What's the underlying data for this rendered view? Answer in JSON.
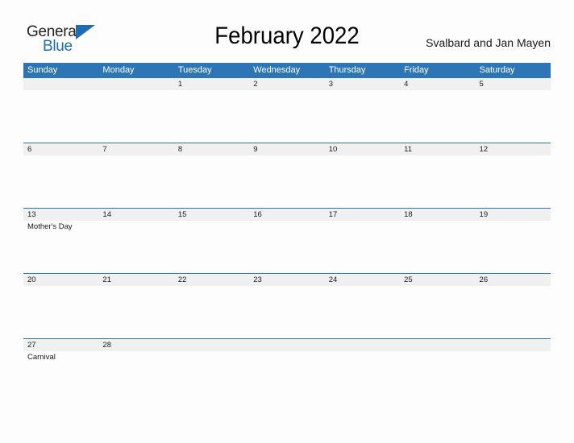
{
  "brand": {
    "name_part1": "General",
    "name_part2": "Blue",
    "triangle_icon": "triangle-icon",
    "color_primary": "#1f6cb5",
    "color_text": "#231f20"
  },
  "header": {
    "title": "February 2022",
    "subtitle": "Svalbard and Jan Mayen"
  },
  "calendar": {
    "accent_color": "#2e75b6",
    "band_color": "#f0f0f0",
    "day_headers": [
      "Sunday",
      "Monday",
      "Tuesday",
      "Wednesday",
      "Thursday",
      "Friday",
      "Saturday"
    ],
    "weeks": [
      {
        "days": [
          {
            "num": "",
            "events": []
          },
          {
            "num": "",
            "events": []
          },
          {
            "num": "1",
            "events": []
          },
          {
            "num": "2",
            "events": []
          },
          {
            "num": "3",
            "events": []
          },
          {
            "num": "4",
            "events": []
          },
          {
            "num": "5",
            "events": []
          }
        ]
      },
      {
        "days": [
          {
            "num": "6",
            "events": []
          },
          {
            "num": "7",
            "events": []
          },
          {
            "num": "8",
            "events": []
          },
          {
            "num": "9",
            "events": []
          },
          {
            "num": "10",
            "events": []
          },
          {
            "num": "11",
            "events": []
          },
          {
            "num": "12",
            "events": []
          }
        ]
      },
      {
        "days": [
          {
            "num": "13",
            "events": [
              "Mother's Day"
            ]
          },
          {
            "num": "14",
            "events": []
          },
          {
            "num": "15",
            "events": []
          },
          {
            "num": "16",
            "events": []
          },
          {
            "num": "17",
            "events": []
          },
          {
            "num": "18",
            "events": []
          },
          {
            "num": "19",
            "events": []
          }
        ]
      },
      {
        "days": [
          {
            "num": "20",
            "events": []
          },
          {
            "num": "21",
            "events": []
          },
          {
            "num": "22",
            "events": []
          },
          {
            "num": "23",
            "events": []
          },
          {
            "num": "24",
            "events": []
          },
          {
            "num": "25",
            "events": []
          },
          {
            "num": "26",
            "events": []
          }
        ]
      },
      {
        "days": [
          {
            "num": "27",
            "events": [
              "Carnival"
            ]
          },
          {
            "num": "28",
            "events": []
          },
          {
            "num": "",
            "events": []
          },
          {
            "num": "",
            "events": []
          },
          {
            "num": "",
            "events": []
          },
          {
            "num": "",
            "events": []
          },
          {
            "num": "",
            "events": []
          }
        ]
      }
    ]
  }
}
